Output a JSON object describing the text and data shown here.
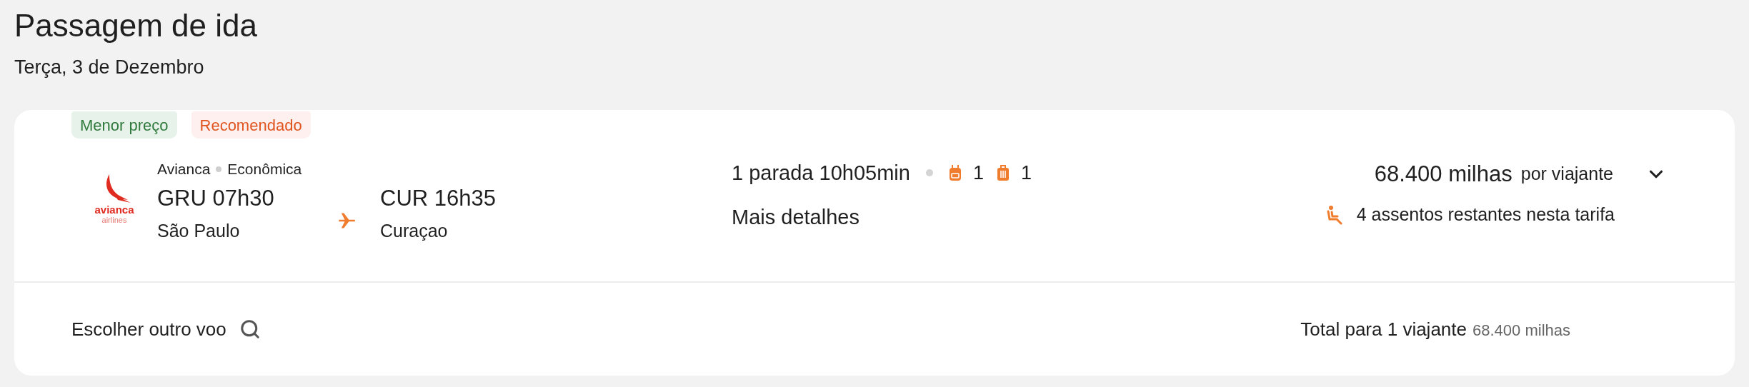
{
  "header": {
    "title": "Passagem de ida",
    "date": "Terça, 3 de Dezembro"
  },
  "flight": {
    "badges": [
      {
        "label": "Menor preço",
        "kind": "best-price"
      },
      {
        "label": "Recomendado",
        "kind": "recommended"
      }
    ],
    "logo_text": "avianca",
    "logo_subtext": "airlines",
    "airline": "Avianca",
    "cabin": "Econômica",
    "departure": {
      "code_time": "GRU 07h30",
      "city": "São Paulo"
    },
    "arrival": {
      "code_time": "CUR 16h35",
      "city": "Curaçao"
    },
    "stops": "1 parada 10h05min",
    "baggage": [
      {
        "kind": "carry-on",
        "count": "1"
      },
      {
        "kind": "checked",
        "count": "1"
      }
    ],
    "details_link": "Mais detalhes",
    "price": "68.400 milhas",
    "price_unit": "por viajante",
    "expanded": false,
    "seats": "4 assentos restantes nesta tarifa"
  },
  "footer": {
    "change_flight": "Escolher outro voo",
    "total_label": "Total para 1 viajante",
    "total_value": "68.400 milhas"
  }
}
